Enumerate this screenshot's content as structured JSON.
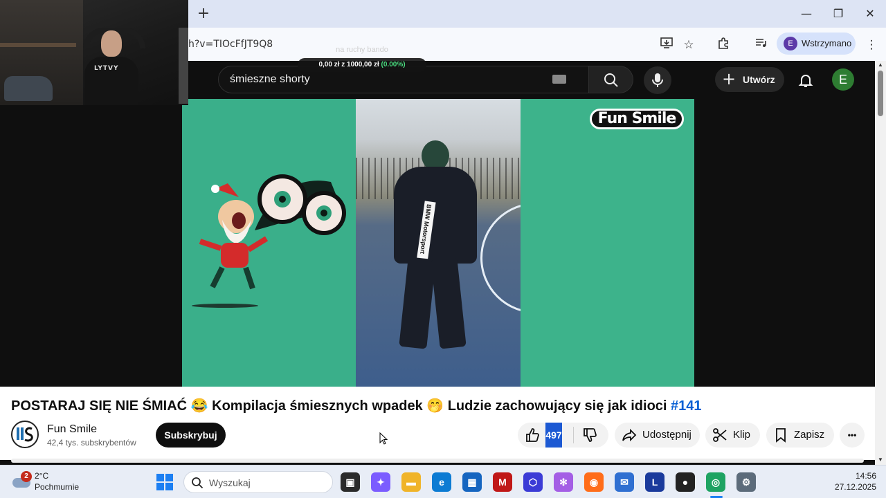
{
  "browser": {
    "new_tab_label": "+",
    "window_controls": {
      "minimize": "—",
      "maximize": "❐",
      "close": "✕"
    },
    "url": "h?v=TIOcFfJT9Q8",
    "profile_initial": "E",
    "profile_status": "Wstrzymano",
    "menu_label": "⋮"
  },
  "stream_overlay": {
    "label": "na ruchy bando",
    "current": "0,00 zł",
    "separator": "z",
    "goal": "1000,00 zł",
    "percent": "(0.00%)",
    "progress": 0.0
  },
  "youtube_header": {
    "search_query": "śmieszne shorty",
    "create_label": "Utwórz",
    "user_initial": "E"
  },
  "video": {
    "watermark": "Fun Smile",
    "hoodie_text": "BMW Motorsport"
  },
  "meta": {
    "title_main": "POSTARAJ SIĘ NIE ŚMIAĆ 😂 Kompilacja śmiesznych wpadek 🤭 Ludzie zachowujący się jak idioci ",
    "title_hashtag": "#141",
    "channel_name": "Fun Smile",
    "subscribers": "42,4 tys. subskrybentów",
    "subscribe_label": "Subskrybuj",
    "like_count": "497",
    "share_label": "Udostępnij",
    "clip_label": "Klip",
    "save_label": "Zapisz",
    "more_label": "•••"
  },
  "webcam": {
    "shirt_text": "LYTVY"
  },
  "taskbar": {
    "weather_badge": "2",
    "temperature": "2°C",
    "condition": "Pochmurnie",
    "search_placeholder": "Wyszukaj",
    "time": "14:56",
    "date": "27.12.2025",
    "apps": [
      {
        "name": "task-view",
        "glyph": "▣",
        "color": "#2b2b2b"
      },
      {
        "name": "copilot",
        "glyph": "✦",
        "color": "#7b5cff"
      },
      {
        "name": "file-explorer",
        "glyph": "▬",
        "color": "#f0b429"
      },
      {
        "name": "edge",
        "glyph": "e",
        "color": "#0c7bd3"
      },
      {
        "name": "store",
        "glyph": "▦",
        "color": "#1565c0"
      },
      {
        "name": "mcafee",
        "glyph": "M",
        "color": "#c01818"
      },
      {
        "name": "shield-app",
        "glyph": "⬡",
        "color": "#3b3bd6"
      },
      {
        "name": "react-app",
        "glyph": "✻",
        "color": "#a45ee5"
      },
      {
        "name": "firefox",
        "glyph": "◉",
        "color": "#ff6d1a"
      },
      {
        "name": "mail",
        "glyph": "✉",
        "color": "#2f6fd1"
      },
      {
        "name": "l-app",
        "glyph": "L",
        "color": "#1a3a9c"
      },
      {
        "name": "obs",
        "glyph": "●",
        "color": "#222"
      },
      {
        "name": "chrome",
        "glyph": "◎",
        "color": "#1ea362"
      },
      {
        "name": "settings",
        "glyph": "⚙",
        "color": "#5c6b7a"
      }
    ]
  }
}
